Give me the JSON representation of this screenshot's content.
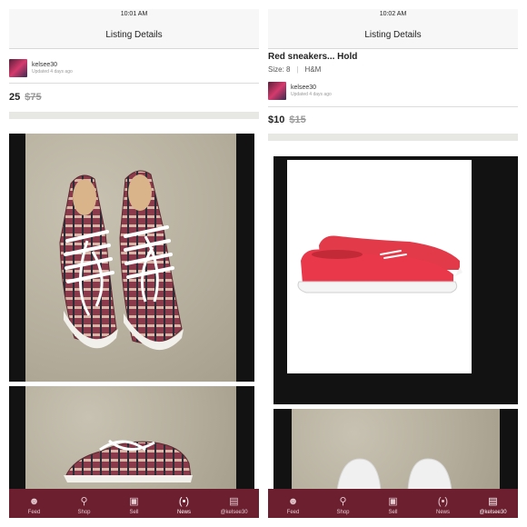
{
  "colors": {
    "tabbar": "#6b1f2f",
    "sneaker_red": "#e8384a",
    "original_price": "#999999"
  },
  "left": {
    "status_time": "10:01 AM",
    "nav_title": "Listing Details",
    "seller": {
      "username": "kelsee30",
      "updated": "Updated 4 days ago"
    },
    "price": "25",
    "original_price": "$75"
  },
  "right": {
    "status_time": "10:02 AM",
    "nav_title": "Listing Details",
    "title": "Red sneakers... Hold",
    "size": "Size: 8",
    "brand": "H&M",
    "seller": {
      "username": "kelsee30",
      "updated": "Updated 4 days ago"
    },
    "price": "$10",
    "original_price": "$15"
  },
  "tabs_left": [
    {
      "label": "Feed",
      "icon": "people-icon"
    },
    {
      "label": "Shop",
      "icon": "search-icon"
    },
    {
      "label": "Sell",
      "icon": "camera-icon"
    },
    {
      "label": "News",
      "icon": "broadcast-icon"
    },
    {
      "label": "@kelsee30",
      "icon": "profile-card-icon"
    }
  ],
  "tabs_right": [
    {
      "label": "Feed",
      "icon": "people-icon"
    },
    {
      "label": "Shop",
      "icon": "search-icon"
    },
    {
      "label": "Sell",
      "icon": "camera-icon"
    },
    {
      "label": "News",
      "icon": "broadcast-icon"
    },
    {
      "label": "@kelsee30",
      "icon": "profile-card-icon"
    }
  ]
}
